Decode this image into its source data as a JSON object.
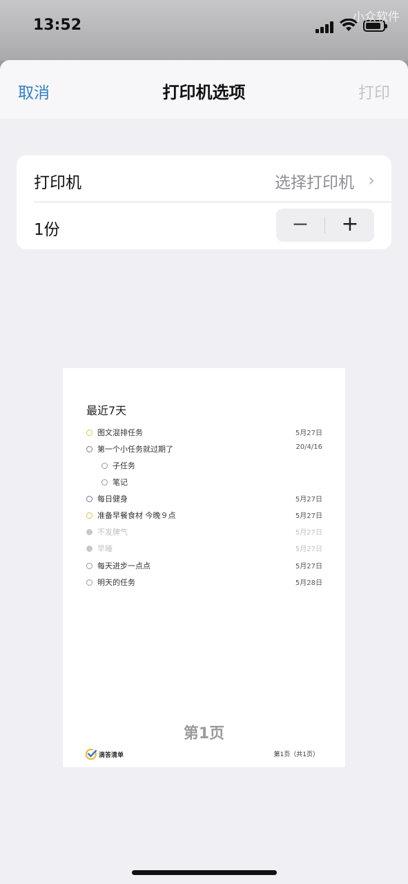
{
  "status": {
    "time": "13:52",
    "watermark": "小众软件"
  },
  "nav": {
    "cancel": "取消",
    "title": "打印机选项",
    "print": "打印"
  },
  "settings": {
    "printer_label": "打印机",
    "printer_value": "选择打印机",
    "copies_label": "1份",
    "minus": "−",
    "plus": "+"
  },
  "preview": {
    "title": "最近7天",
    "tasks": [
      {
        "name": "图文混排任务",
        "date": "5月27日",
        "state": "open",
        "color": "yellow"
      },
      {
        "name": "第一个小任务就过期了",
        "date": "20/4/16",
        "state": "open",
        "color": "purple"
      },
      {
        "name": "子任务",
        "date": "",
        "state": "open",
        "color": "gray"
      },
      {
        "name": "笔记",
        "date": "",
        "state": "open",
        "color": "gray"
      },
      {
        "name": "每日健身",
        "date": "5月27日",
        "state": "open",
        "color": "purple"
      },
      {
        "name": "准备早餐食材 今晚９点",
        "date": "5月27日",
        "state": "open",
        "color": "yellow"
      },
      {
        "name": "不发脾气",
        "date": "5月27日",
        "state": "completed",
        "color": "gray"
      },
      {
        "name": "早睡",
        "date": "5月27日",
        "state": "completed",
        "color": "gray"
      },
      {
        "name": "每天进步一点点",
        "date": "5月27日",
        "state": "open",
        "color": "gray"
      },
      {
        "name": "明天的任务",
        "date": "5月28日",
        "state": "open",
        "color": "gray"
      }
    ],
    "page_label": "第1页",
    "logo_text": "滴答清单",
    "footer_page": "第1页（共1页）"
  }
}
